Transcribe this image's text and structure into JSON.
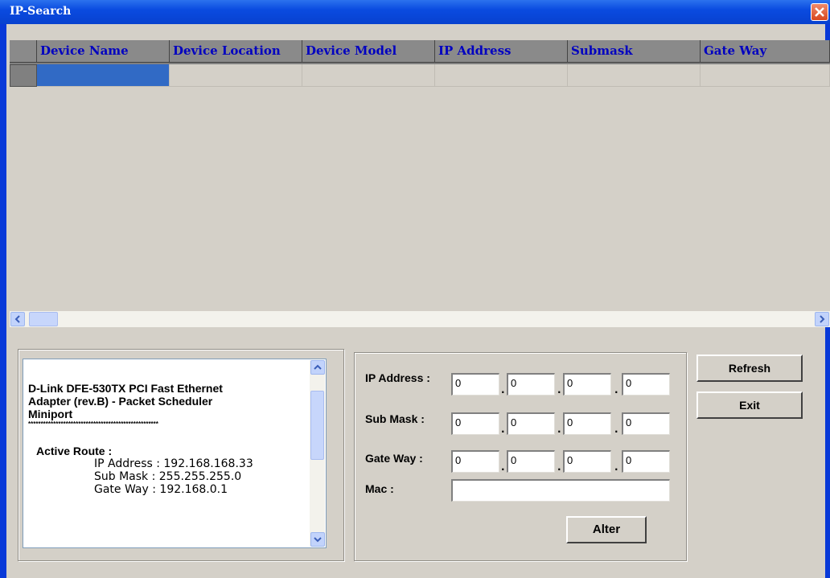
{
  "window": {
    "title": "IP-Search"
  },
  "grid": {
    "columns": [
      "Device Name",
      "Device Location",
      "Device Model",
      "IP Address",
      "Submask",
      "Gate Way"
    ]
  },
  "info": {
    "adapter_line1": "D-Link DFE-530TX PCI Fast Ethernet",
    "adapter_line2": "Adapter (rev.B) - Packet Scheduler",
    "adapter_line3": "Miniport",
    "separator": "****************************************************",
    "active_route": "Active Route :",
    "ip": "IP Address : 192.168.168.33",
    "mask": "Sub Mask : 255.255.255.0",
    "gateway": "Gate Way : 192.168.0.1"
  },
  "form": {
    "ip_label": "IP Address :",
    "mask_label": "Sub Mask :",
    "gateway_label": "Gate Way :",
    "mac_label": "Mac :",
    "ip": [
      "0",
      "0",
      "0",
      "0"
    ],
    "mask": [
      "0",
      "0",
      "0",
      "0"
    ],
    "gateway": [
      "0",
      "0",
      "0",
      "0"
    ],
    "mac": "",
    "alter_label": "Alter"
  },
  "buttons": {
    "refresh": "Refresh",
    "exit": "Exit"
  }
}
